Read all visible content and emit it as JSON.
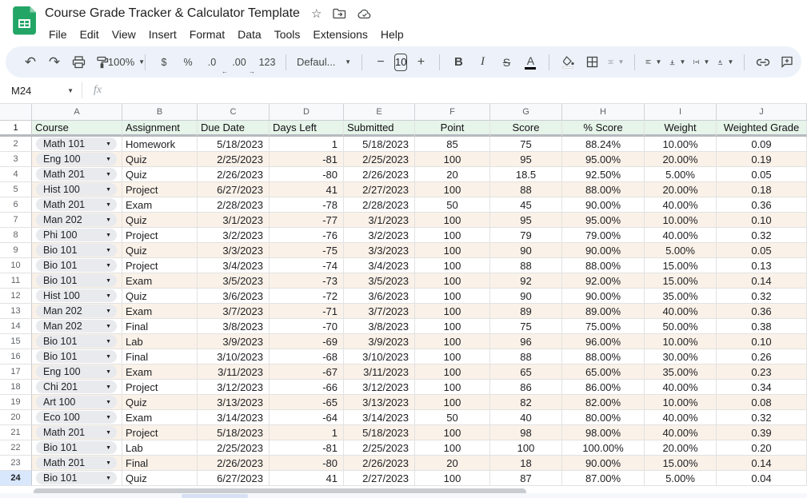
{
  "titlebar": {
    "title": "Course Grade Tracker & Calculator Template",
    "star_icon": "star-icon",
    "move_icon": "move-to-folder-icon",
    "cloud_icon": "cloud-saved-icon"
  },
  "menubar": {
    "items": [
      "File",
      "Edit",
      "View",
      "Insert",
      "Format",
      "Data",
      "Tools",
      "Extensions",
      "Help"
    ]
  },
  "toolbar": {
    "zoom": "100%",
    "currency": "$",
    "percent": "%",
    "decrease_decimal": ".0",
    "increase_decimal": ".00",
    "more_formats": "123",
    "font_style": "Defaul...",
    "minus": "−",
    "font_size": "10",
    "plus": "+",
    "bold": "B",
    "italic": "I",
    "strikethrough": "S",
    "text_color": "A"
  },
  "formula_bar": {
    "name_box": "M24",
    "fx": "fx",
    "formula": ""
  },
  "sheet": {
    "column_letters": [
      "A",
      "B",
      "C",
      "D",
      "E",
      "F",
      "G",
      "H",
      "I",
      "J"
    ],
    "header_row": [
      "Course",
      "Assignment",
      "Due Date",
      "Days Left",
      "Submitted",
      "Point",
      "Score",
      "% Score",
      "Weight",
      "Weighted Grade"
    ],
    "selected_row": 24,
    "rows": [
      {
        "n": 2,
        "cells": [
          "Math 101",
          "Homework",
          "5/18/2023",
          "1",
          "5/18/2023",
          "85",
          "75",
          "88.24%",
          "10.00%",
          "0.09"
        ]
      },
      {
        "n": 3,
        "cells": [
          "Eng 100",
          "Quiz",
          "2/25/2023",
          "-81",
          "2/25/2023",
          "100",
          "95",
          "95.00%",
          "20.00%",
          "0.19"
        ]
      },
      {
        "n": 4,
        "cells": [
          "Math 201",
          "Quiz",
          "2/26/2023",
          "-80",
          "2/26/2023",
          "20",
          "18.5",
          "92.50%",
          "5.00%",
          "0.05"
        ]
      },
      {
        "n": 5,
        "cells": [
          "Hist 100",
          "Project",
          "6/27/2023",
          "41",
          "2/27/2023",
          "100",
          "88",
          "88.00%",
          "20.00%",
          "0.18"
        ]
      },
      {
        "n": 6,
        "cells": [
          "Math 201",
          "Exam",
          "2/28/2023",
          "-78",
          "2/28/2023",
          "50",
          "45",
          "90.00%",
          "40.00%",
          "0.36"
        ]
      },
      {
        "n": 7,
        "cells": [
          "Man 202",
          "Quiz",
          "3/1/2023",
          "-77",
          "3/1/2023",
          "100",
          "95",
          "95.00%",
          "10.00%",
          "0.10"
        ]
      },
      {
        "n": 8,
        "cells": [
          "Phi 100",
          "Project",
          "3/2/2023",
          "-76",
          "3/2/2023",
          "100",
          "79",
          "79.00%",
          "40.00%",
          "0.32"
        ]
      },
      {
        "n": 9,
        "cells": [
          "Bio 101",
          "Quiz",
          "3/3/2023",
          "-75",
          "3/3/2023",
          "100",
          "90",
          "90.00%",
          "5.00%",
          "0.05"
        ]
      },
      {
        "n": 10,
        "cells": [
          "Bio 101",
          "Project",
          "3/4/2023",
          "-74",
          "3/4/2023",
          "100",
          "88",
          "88.00%",
          "15.00%",
          "0.13"
        ]
      },
      {
        "n": 11,
        "cells": [
          "Bio 101",
          "Exam",
          "3/5/2023",
          "-73",
          "3/5/2023",
          "100",
          "92",
          "92.00%",
          "15.00%",
          "0.14"
        ]
      },
      {
        "n": 12,
        "cells": [
          "Hist 100",
          "Quiz",
          "3/6/2023",
          "-72",
          "3/6/2023",
          "100",
          "90",
          "90.00%",
          "35.00%",
          "0.32"
        ]
      },
      {
        "n": 13,
        "cells": [
          "Man 202",
          "Exam",
          "3/7/2023",
          "-71",
          "3/7/2023",
          "100",
          "89",
          "89.00%",
          "40.00%",
          "0.36"
        ]
      },
      {
        "n": 14,
        "cells": [
          "Man 202",
          "Final",
          "3/8/2023",
          "-70",
          "3/8/2023",
          "100",
          "75",
          "75.00%",
          "50.00%",
          "0.38"
        ]
      },
      {
        "n": 15,
        "cells": [
          "Bio 101",
          "Lab",
          "3/9/2023",
          "-69",
          "3/9/2023",
          "100",
          "96",
          "96.00%",
          "10.00%",
          "0.10"
        ]
      },
      {
        "n": 16,
        "cells": [
          "Bio 101",
          "Final",
          "3/10/2023",
          "-68",
          "3/10/2023",
          "100",
          "88",
          "88.00%",
          "30.00%",
          "0.26"
        ]
      },
      {
        "n": 17,
        "cells": [
          "Eng 100",
          "Exam",
          "3/11/2023",
          "-67",
          "3/11/2023",
          "100",
          "65",
          "65.00%",
          "35.00%",
          "0.23"
        ]
      },
      {
        "n": 18,
        "cells": [
          "Chi 201",
          "Project",
          "3/12/2023",
          "-66",
          "3/12/2023",
          "100",
          "86",
          "86.00%",
          "40.00%",
          "0.34"
        ]
      },
      {
        "n": 19,
        "cells": [
          "Art 100",
          "Quiz",
          "3/13/2023",
          "-65",
          "3/13/2023",
          "100",
          "82",
          "82.00%",
          "10.00%",
          "0.08"
        ]
      },
      {
        "n": 20,
        "cells": [
          "Eco 100",
          "Exam",
          "3/14/2023",
          "-64",
          "3/14/2023",
          "50",
          "40",
          "80.00%",
          "40.00%",
          "0.32"
        ]
      },
      {
        "n": 21,
        "cells": [
          "Math 201",
          "Project",
          "5/18/2023",
          "1",
          "5/18/2023",
          "100",
          "98",
          "98.00%",
          "40.00%",
          "0.39"
        ]
      },
      {
        "n": 22,
        "cells": [
          "Bio 101",
          "Lab",
          "2/25/2023",
          "-81",
          "2/25/2023",
          "100",
          "100",
          "100.00%",
          "20.00%",
          "0.20"
        ]
      },
      {
        "n": 23,
        "cells": [
          "Math 201",
          "Final",
          "2/26/2023",
          "-80",
          "2/26/2023",
          "20",
          "18",
          "90.00%",
          "15.00%",
          "0.14"
        ]
      },
      {
        "n": 24,
        "cells": [
          "Bio 101",
          "Quiz",
          "6/27/2023",
          "41",
          "2/27/2023",
          "100",
          "87",
          "87.00%",
          "5.00%",
          "0.04"
        ]
      }
    ],
    "colors": {
      "header_row_bg": "#e6f4ea",
      "alt_row_bg": "#faf1e8",
      "chip_bg": "#e8eaed",
      "selected_row_header_bg": "#d9e7fd",
      "toolbar_bg": "#edf2fa",
      "logo_green": "#23a566"
    }
  }
}
